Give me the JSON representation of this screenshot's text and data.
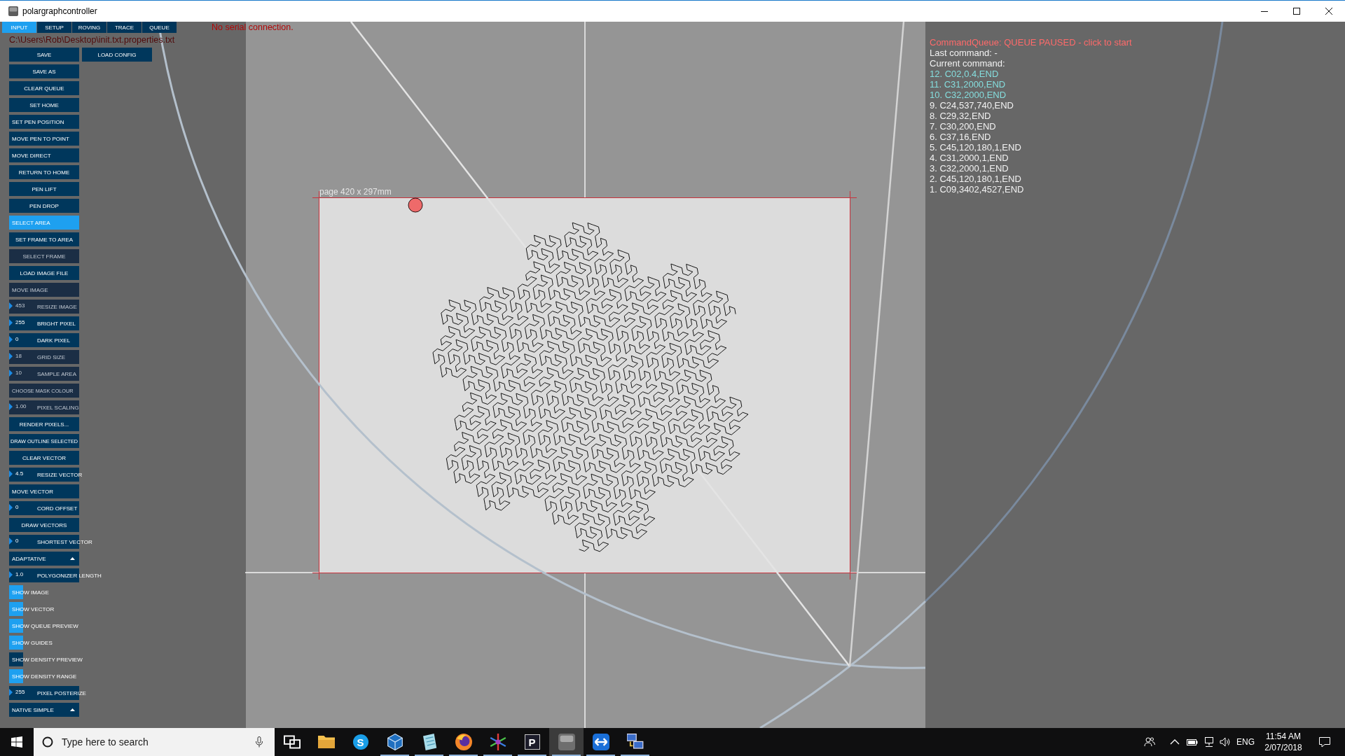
{
  "window": {
    "title": "polargraphcontroller"
  },
  "tabs": [
    {
      "label": "INPUT",
      "selected": true
    },
    {
      "label": "SETUP",
      "selected": false
    },
    {
      "label": "ROVING",
      "selected": false
    },
    {
      "label": "TRACE",
      "selected": false
    },
    {
      "label": "QUEUE",
      "selected": false
    }
  ],
  "status": {
    "serial": "No serial connection.",
    "config_path": "C:\\Users\\Rob\\Desktop\\init.txt.properties.txt"
  },
  "sidebar": {
    "controls": [
      [
        {
          "kind": "button",
          "label": "SAVE",
          "disabled": false
        },
        {
          "kind": "button",
          "label": "LOAD CONFIG",
          "disabled": false
        }
      ],
      [
        {
          "kind": "button",
          "label": "SAVE AS",
          "disabled": false
        }
      ],
      [
        {
          "kind": "button",
          "label": "CLEAR QUEUE",
          "disabled": false
        }
      ],
      [
        {
          "kind": "button",
          "label": "SET HOME",
          "disabled": false
        }
      ],
      [
        {
          "kind": "mode",
          "label": "SET PEN POSITION",
          "selected": false,
          "disabled": false
        }
      ],
      [
        {
          "kind": "mode",
          "label": "MOVE PEN TO POINT",
          "selected": false,
          "disabled": false
        }
      ],
      [
        {
          "kind": "mode",
          "label": "MOVE DIRECT",
          "selected": false,
          "disabled": false
        }
      ],
      [
        {
          "kind": "button",
          "label": "RETURN TO HOME",
          "disabled": false
        }
      ],
      [
        {
          "kind": "button",
          "label": "PEN LIFT",
          "disabled": false
        }
      ],
      [
        {
          "kind": "button",
          "label": "PEN DROP",
          "disabled": false
        }
      ],
      [
        {
          "kind": "mode",
          "label": "SELECT AREA",
          "selected": true,
          "disabled": false
        }
      ],
      [
        {
          "kind": "button",
          "label": "SET FRAME TO AREA",
          "disabled": false
        }
      ],
      [
        {
          "kind": "button",
          "label": "SELECT FRAME",
          "disabled": true
        }
      ],
      [
        {
          "kind": "button",
          "label": "LOAD IMAGE FILE",
          "disabled": false
        }
      ],
      [
        {
          "kind": "mode",
          "label": "MOVE IMAGE",
          "selected": false,
          "disabled": true
        }
      ],
      [
        {
          "kind": "number",
          "value": "453",
          "label": "RESIZE IMAGE",
          "disabled": true
        }
      ],
      [
        {
          "kind": "number",
          "value": "255",
          "label": "BRIGHT PIXEL",
          "disabled": false
        }
      ],
      [
        {
          "kind": "number",
          "value": "0",
          "label": "DARK PIXEL",
          "disabled": false
        }
      ],
      [
        {
          "kind": "number",
          "value": "18",
          "label": "GRID SIZE",
          "disabled": true
        }
      ],
      [
        {
          "kind": "number",
          "value": "10",
          "label": "SAMPLE AREA",
          "disabled": true
        }
      ],
      [
        {
          "kind": "mode",
          "label": "CHOOSE MASK COLOUR",
          "selected": false,
          "disabled": true
        }
      ],
      [
        {
          "kind": "number",
          "value": "1.00",
          "label": "PIXEL SCALING",
          "disabled": true
        }
      ],
      [
        {
          "kind": "button",
          "label": "RENDER PIXELS...",
          "disabled": false
        }
      ],
      [
        {
          "kind": "button",
          "label": "DRAW OUTLINE SELECTED",
          "disabled": false
        }
      ],
      [
        {
          "kind": "button",
          "label": "CLEAR VECTOR",
          "disabled": false
        }
      ],
      [
        {
          "kind": "number",
          "value": "4.5",
          "label": "RESIZE VECTOR",
          "disabled": false
        }
      ],
      [
        {
          "kind": "mode",
          "label": "MOVE VECTOR",
          "selected": false,
          "disabled": false
        }
      ],
      [
        {
          "kind": "number",
          "value": "0",
          "label": "CORD OFFSET",
          "disabled": false
        }
      ],
      [
        {
          "kind": "button",
          "label": "DRAW VECTORS",
          "disabled": false
        }
      ],
      [
        {
          "kind": "number",
          "value": "0",
          "label": "SHORTEST VECTOR",
          "disabled": false
        }
      ],
      [
        {
          "kind": "dropdown",
          "label": "ADAPTATIVE"
        }
      ],
      [
        {
          "kind": "number",
          "value": "1.0",
          "label": "POLYGONIZER LENGTH",
          "disabled": false
        }
      ],
      [
        {
          "kind": "checkbox",
          "label": "SHOW IMAGE",
          "checked": true
        }
      ],
      [
        {
          "kind": "checkbox",
          "label": "SHOW VECTOR",
          "checked": true
        }
      ],
      [
        {
          "kind": "checkbox",
          "label": "SHOW QUEUE PREVIEW",
          "checked": true
        }
      ],
      [
        {
          "kind": "checkbox",
          "label": "SHOW GUIDES",
          "checked": true
        }
      ],
      [
        {
          "kind": "checkbox",
          "label": "SHOW DENSITY PREVIEW",
          "checked": false
        }
      ],
      [
        {
          "kind": "checkbox",
          "label": "SHOW DENSITY RANGE",
          "checked": true
        }
      ],
      [
        {
          "kind": "number",
          "value": "255",
          "label": "PIXEL POSTERIZE",
          "disabled": false
        }
      ],
      [
        {
          "kind": "dropdown",
          "label": "NATIVE SIMPLE"
        }
      ]
    ]
  },
  "canvas": {
    "page_label": "page 420 x 297mm"
  },
  "queue": {
    "status": "CommandQueue: QUEUE PAUSED - click to start",
    "last_command": "Last command: -",
    "current_command": "Current command:",
    "items": [
      {
        "text": "12. C02,0.4,END",
        "highlighted": true
      },
      {
        "text": "11. C31,2000,END",
        "highlighted": true
      },
      {
        "text": "10. C32,2000,END",
        "highlighted": true
      },
      {
        "text": "9. C24,537,740,END",
        "highlighted": false
      },
      {
        "text": "8. C29,32,END",
        "highlighted": false
      },
      {
        "text": "7. C30,200,END",
        "highlighted": false
      },
      {
        "text": "6. C37,16,END",
        "highlighted": false
      },
      {
        "text": "5. C45,120,180,1,END",
        "highlighted": false
      },
      {
        "text": "4. C31,2000,1,END",
        "highlighted": false
      },
      {
        "text": "3. C32,2000,1,END",
        "highlighted": false
      },
      {
        "text": "2. C45,120,180,1,END",
        "highlighted": false
      },
      {
        "text": "1. C09,3402,4527,END",
        "highlighted": false
      }
    ]
  },
  "taskbar": {
    "search": {
      "placeholder": "Type here to search"
    },
    "apps": [
      {
        "kind": "task-view",
        "running": false,
        "selected": false
      },
      {
        "kind": "folder",
        "running": false,
        "selected": false
      },
      {
        "kind": "letter-circle",
        "glyph": "S",
        "running": false,
        "selected": false
      },
      {
        "kind": "cube",
        "running": true,
        "selected": false
      },
      {
        "kind": "sheet",
        "running": true,
        "selected": false
      },
      {
        "kind": "globe",
        "running": true,
        "selected": false
      },
      {
        "kind": "starburst",
        "running": true,
        "selected": false
      },
      {
        "kind": "letter-tile",
        "glyph": "P",
        "running": true,
        "selected": false
      },
      {
        "kind": "window",
        "running": true,
        "selected": true
      },
      {
        "kind": "remote",
        "running": true,
        "selected": false
      },
      {
        "kind": "network",
        "running": true,
        "selected": false
      }
    ],
    "tray": {
      "language": "ENG",
      "time": "11:54 AM",
      "date": "2/07/2018"
    }
  }
}
